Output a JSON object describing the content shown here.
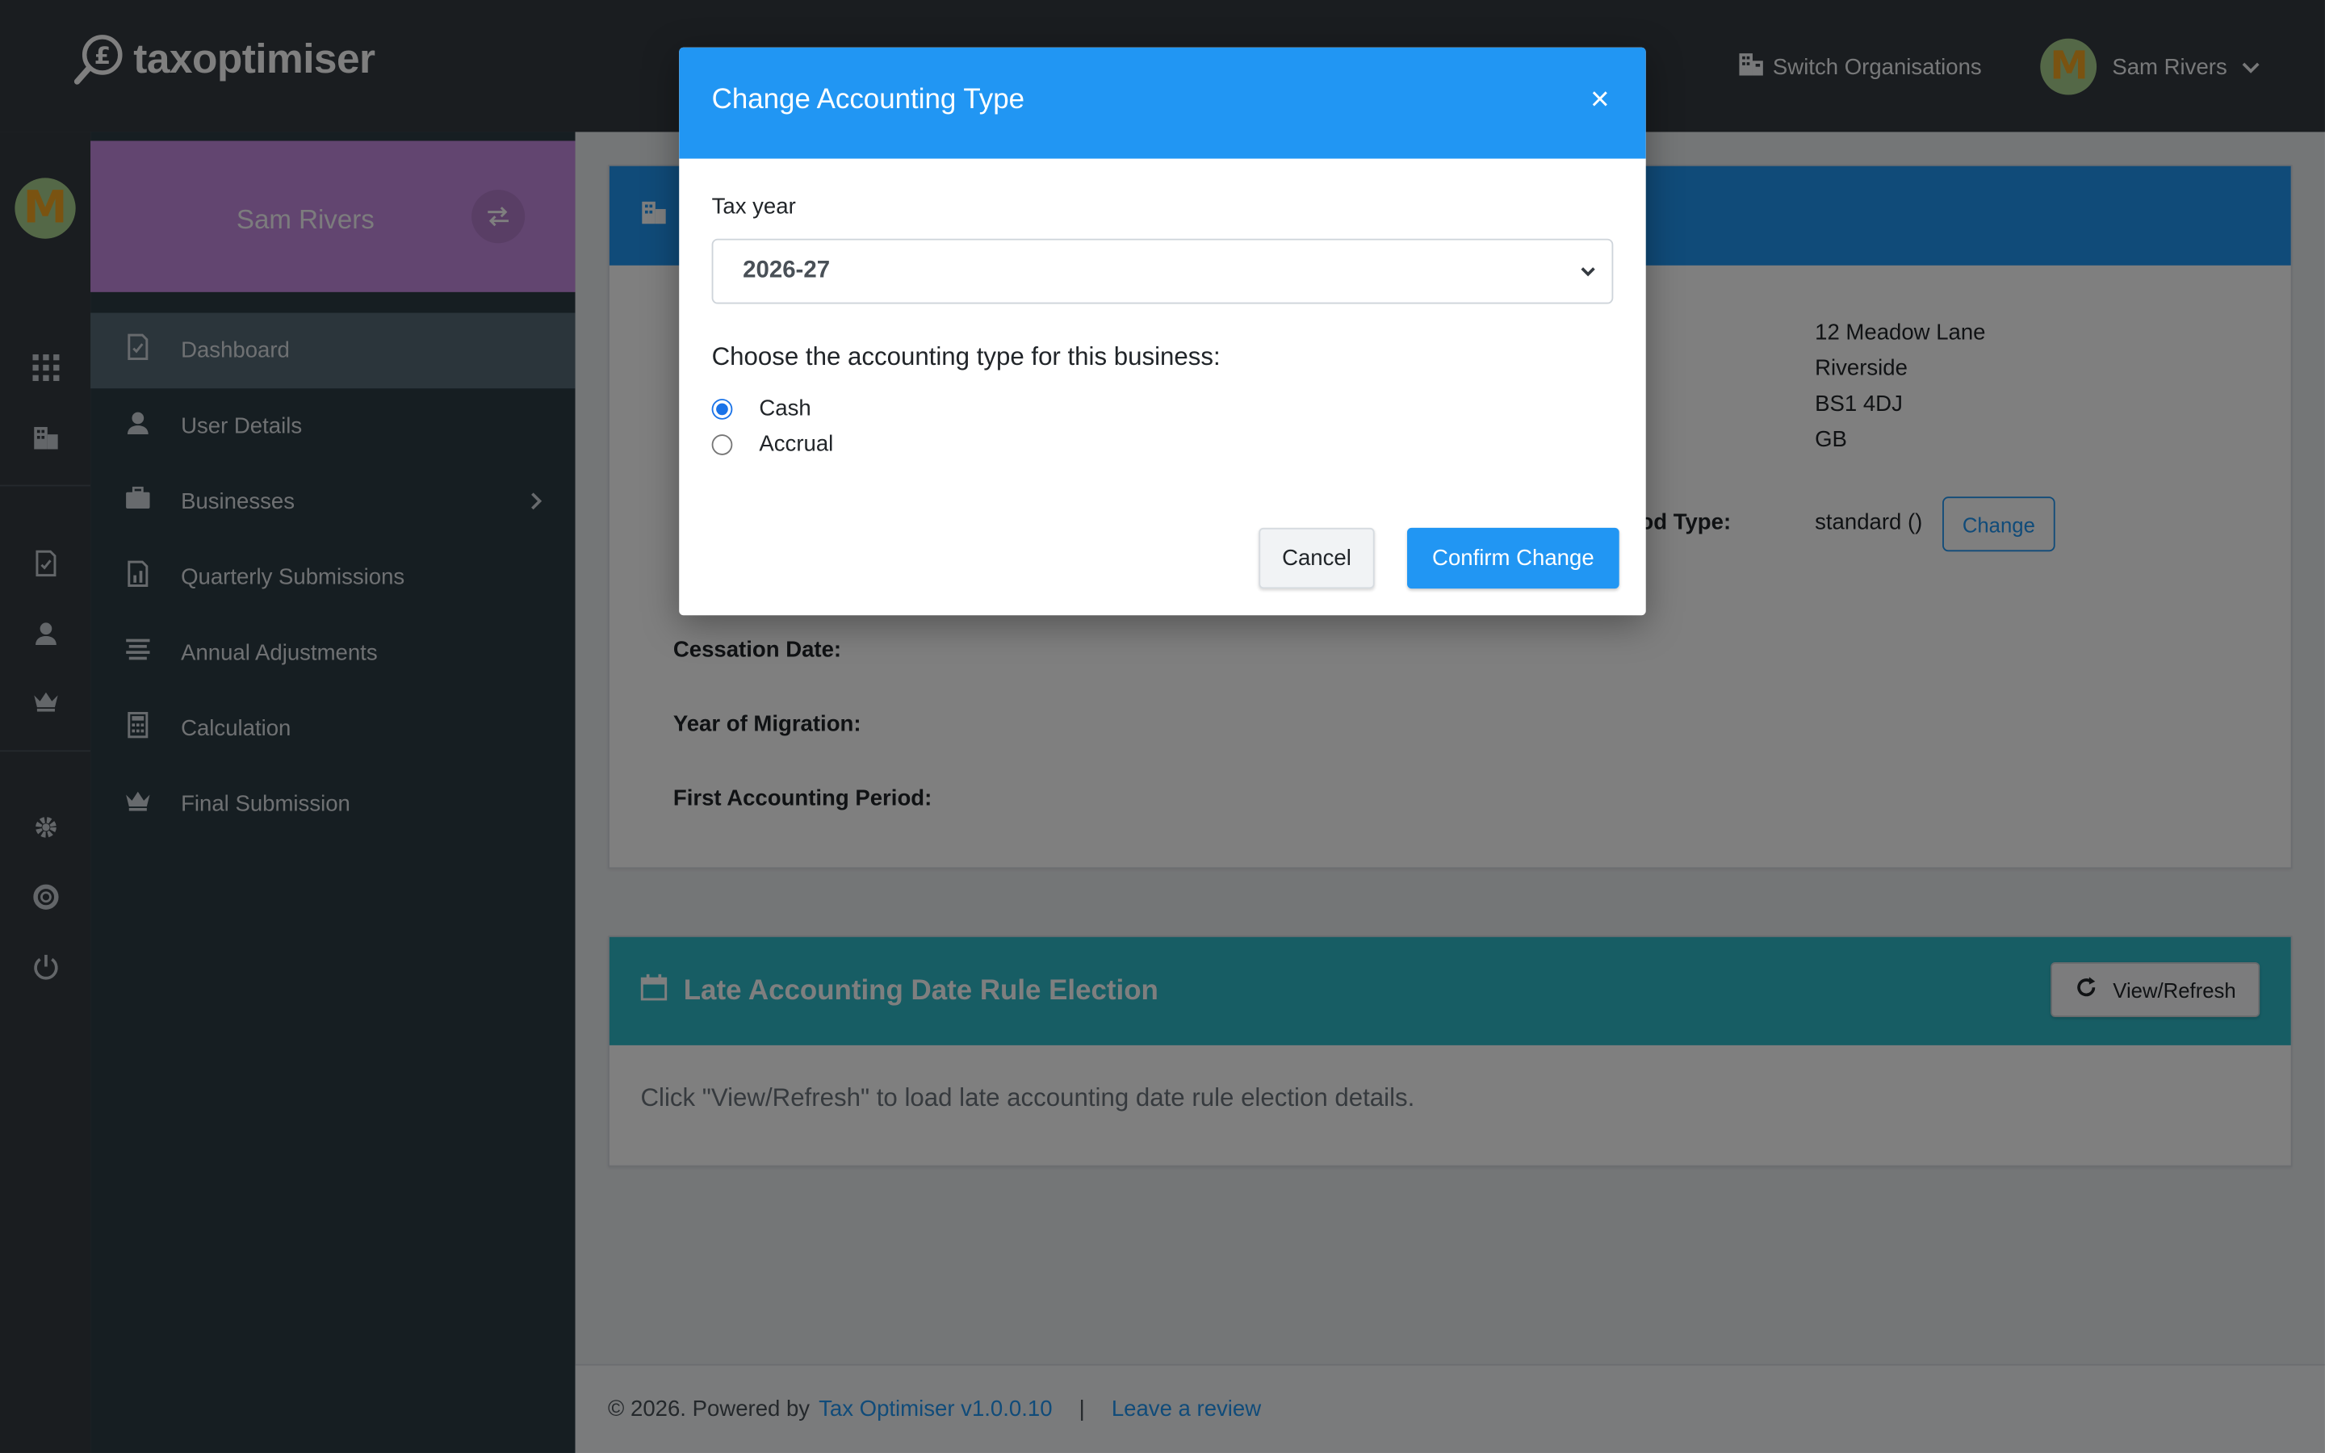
{
  "app": {
    "brand_name": "taxoptimiser",
    "switch_org_label": "Switch Organisations",
    "user_name": "Sam Rivers",
    "avatar_letter": "M"
  },
  "sidebar": {
    "profile_name": "Sam Rivers",
    "items": [
      {
        "label": "Dashboard",
        "icon": "dashboard-icon",
        "active": true
      },
      {
        "label": "User Details",
        "icon": "user-icon"
      },
      {
        "label": "Businesses",
        "icon": "briefcase-icon",
        "has_children": true
      },
      {
        "label": "Quarterly Submissions",
        "icon": "report-icon"
      },
      {
        "label": "Annual Adjustments",
        "icon": "list-icon"
      },
      {
        "label": "Calculation",
        "icon": "calculator-icon"
      },
      {
        "label": "Final Submission",
        "icon": "crown-icon"
      }
    ]
  },
  "business_card": {
    "address_lines": [
      "12 Meadow Lane",
      "Riverside",
      "BS1 4DJ",
      "GB"
    ],
    "period_type_label": "od Type:",
    "period_type_value": "standard ()",
    "change_label": "Change",
    "cessation_label": "Cessation Date:",
    "migration_label": "Year of Migration:",
    "first_period_label": "First Accounting Period:"
  },
  "late_card": {
    "title": "Late Accounting Date Rule Election",
    "refresh_label": "View/Refresh",
    "body": "Click \"View/Refresh\" to load late accounting date rule election details."
  },
  "footer": {
    "copyright": "© 2026. Powered by",
    "version_link": "Tax Optimiser v1.0.0.10",
    "separator": "|",
    "review_link": "Leave a review"
  },
  "modal": {
    "title": "Change Accounting Type",
    "close_glyph": "×",
    "tax_year_label": "Tax year",
    "tax_year_value": "2026-27",
    "question": "Choose the accounting type for this business:",
    "options": [
      {
        "label": "Cash",
        "checked": true
      },
      {
        "label": "Accrual",
        "checked": false
      }
    ],
    "cancel_label": "Cancel",
    "confirm_label": "Confirm Change"
  },
  "colors": {
    "accent": "#2196f3",
    "navbar": "#343a40",
    "sidebar": "#2d3c45",
    "profile": "#c58ae0",
    "card_head_blue": "#2196f3",
    "card_head_teal": "#2fbac9"
  }
}
